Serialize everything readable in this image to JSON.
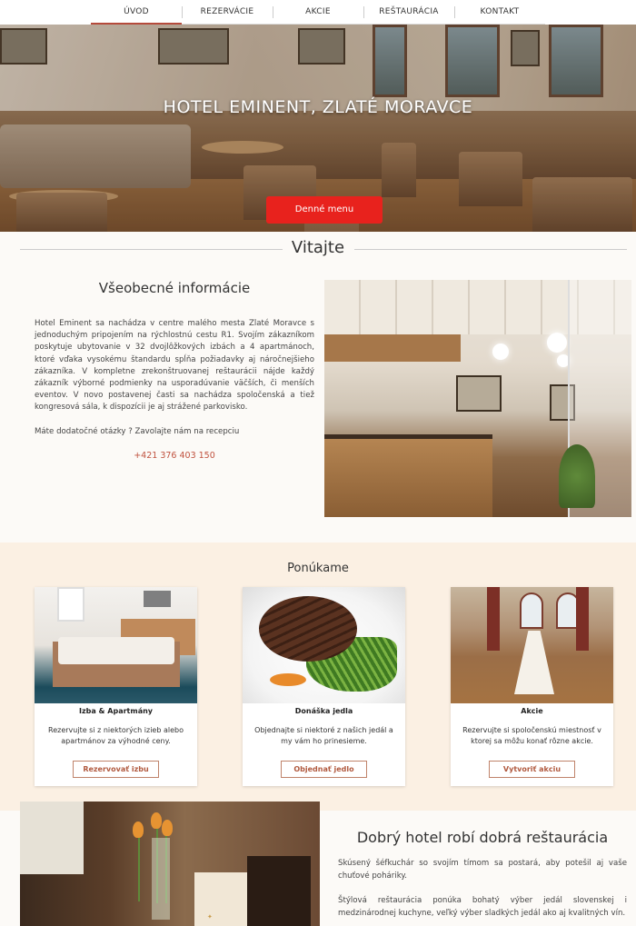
{
  "nav": {
    "items": [
      {
        "label": "ÚVOD"
      },
      {
        "label": "REZERVÁCIE"
      },
      {
        "label": "AKCIE"
      },
      {
        "label": "REŠTAURÁCIA"
      },
      {
        "label": "KONTAKT"
      }
    ],
    "active_index": 0
  },
  "hero": {
    "title": "HOTEL EMINENT, ZLATÉ MORAVCE",
    "button_label": "Denné menu",
    "button_color": "#e8221d"
  },
  "welcome": {
    "title": "Vitajte"
  },
  "info": {
    "title": "Všeobecné informácie",
    "body": "Hotel Eminent sa nachádza v centre malého mesta Zlaté Moravce s jednoduchým pripojením na rýchlostnú cestu R1. Svojím zákazníkom poskytuje ubytovanie v 32 dvojlôžkových izbách a 4 apartmánoch, ktoré vďaka vysokému štandardu spĺňa požiadavky aj náročnejšieho zákazníka. V kompletne zrekonštruovanej reštaurácii nájde každý zákazník výborné podmienky na usporadúvanie väčších, či menších eventov. V novo postavenej časti sa nachádza spoločenská a tiež kongresová sála, k dispozícii je aj strážené parkovisko.",
    "question": "Máte dodatočné otázky ? Zavolajte nám na recepciu",
    "phone": "+421 376 403 150",
    "phone_color": "#c0523f"
  },
  "offers": {
    "title": "Ponúkame",
    "background": "#fbf0e3",
    "cards": [
      {
        "title": "Izba & Apartmány",
        "description": "Rezervujte si z niektorých izieb alebo apartmánov za výhodné ceny.",
        "button": "Rezervovať izbu"
      },
      {
        "title": "Donáška jedla",
        "description": "Objednajte si niektoré z našich jedál a my vám ho prinesieme.",
        "button": "Objednať jedlo"
      },
      {
        "title": "Akcie",
        "description": "Rezervujte si spoločenskú miestnosť v ktorej sa môžu konať rôzne akcie.",
        "button": "Vytvoriť akciu"
      }
    ]
  },
  "good": {
    "title": "Dobrý hotel robí dobrá reštaurácia",
    "p1": "Skúsený šéfkuchár so svojím tímom sa postará, aby potešil aj vaše chuťové poháriky.",
    "p2": "Štýlová reštaurácia ponúka bohatý výber jedál slovenskej i medzinárodnej kuchyne, veľký výber sladkých jedál ako aj kvalitných vín."
  },
  "accent_color": "#b15a3f"
}
